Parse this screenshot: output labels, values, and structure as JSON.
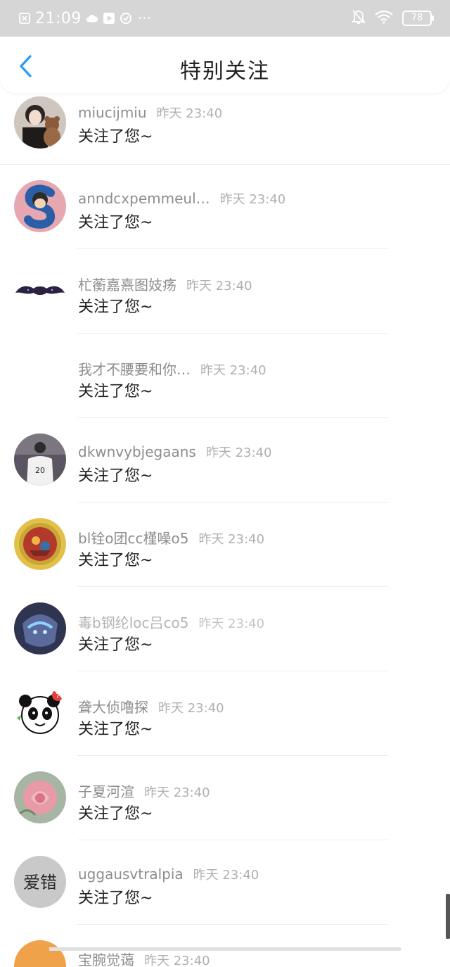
{
  "status_bar": {
    "time": "21:09",
    "battery": "78",
    "icons": [
      "close-box-icon",
      "cloud-icon",
      "play-icon",
      "refresh-icon",
      "more-dots-icon",
      "mute-bell-icon",
      "wifi-icon",
      "battery-icon"
    ]
  },
  "navbar": {
    "title": "特别关注",
    "back_icon": "chevron-left-icon",
    "accent": "#2b9af3"
  },
  "rows": [
    {
      "name": "miucijmiu",
      "time": "昨天 23:40",
      "msg": "关注了您~",
      "avatar": "girl-bear-photo"
    },
    {
      "name": "anndcxpemmeul…",
      "time": "昨天 23:40",
      "msg": "关注了您~",
      "avatar": "s-cartoon"
    },
    {
      "name": "杧蘅嘉熹图妓疡",
      "time": "昨天 23:40",
      "msg": "关注了您~",
      "avatar": "mustache"
    },
    {
      "name": "我才不腰要和你…",
      "time": "昨天 23:40",
      "msg": "关注了您~",
      "avatar": "blank"
    },
    {
      "name": "dkwnvybjegaans",
      "time": "昨天 23:40",
      "msg": "关注了您~",
      "avatar": "jersey-photo"
    },
    {
      "name": "bl铨o团cc槿噪o5",
      "time": "昨天 23:40",
      "msg": "关注了您~",
      "avatar": "gold-coin"
    },
    {
      "name": "毒b钢纶loc吕co5",
      "time": "昨天 23:40",
      "msg": "关注了您~",
      "avatar": "blue-robot"
    },
    {
      "name": "聋大侦噜探",
      "time": "昨天 23:40",
      "msg": "关注了您~",
      "avatar": "panda"
    },
    {
      "name": "子夏河渲",
      "time": "昨天 23:40",
      "msg": "关注了您~",
      "avatar": "pink-rose"
    },
    {
      "name": "uggausvtralpia",
      "time": "昨天 23:40",
      "msg": "关注了您~",
      "avatar": "calligraphy"
    }
  ],
  "partial_row": {
    "name": "宝腕觉蔼",
    "time": "昨天 23:40",
    "avatar": "orange"
  },
  "calligraphy_text": "爱错"
}
